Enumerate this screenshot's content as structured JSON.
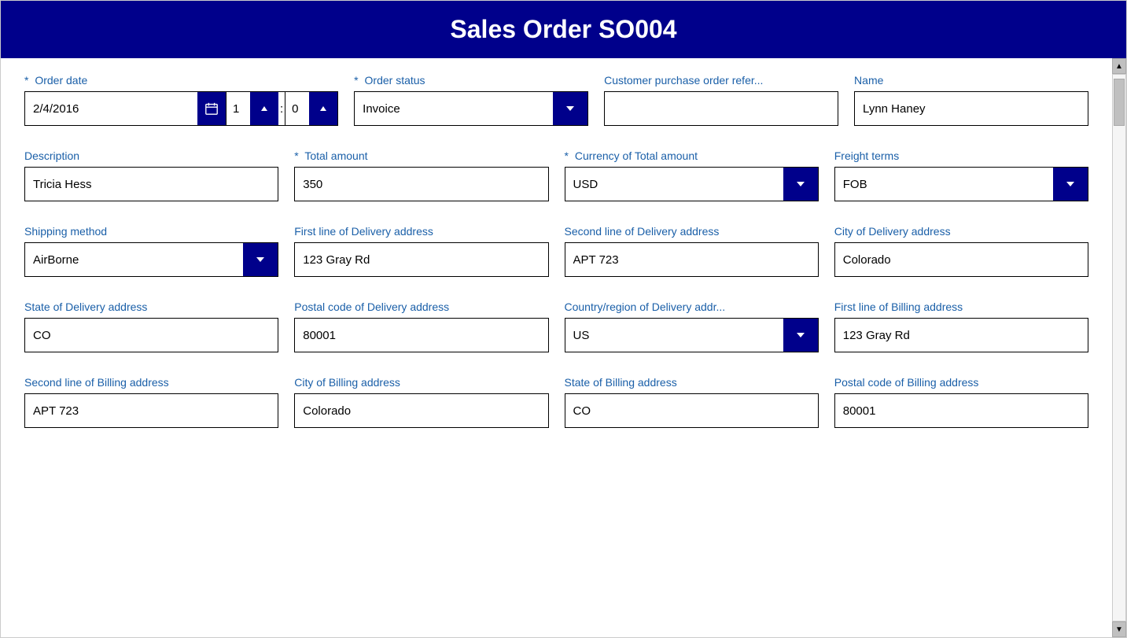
{
  "header": {
    "title": "Sales Order SO004"
  },
  "form": {
    "fields": {
      "order_date": {
        "label": "Order date",
        "required": true,
        "value": "2/4/2016",
        "hour": "1",
        "minute": "0"
      },
      "order_status": {
        "label": "Order status",
        "required": true,
        "value": "Invoice"
      },
      "customer_po_ref": {
        "label": "Customer purchase order refer...",
        "required": false,
        "value": ""
      },
      "name": {
        "label": "Name",
        "required": false,
        "value": "Lynn Haney"
      },
      "description": {
        "label": "Description",
        "required": false,
        "value": "Tricia Hess"
      },
      "total_amount": {
        "label": "Total amount",
        "required": true,
        "value": "350"
      },
      "currency_total": {
        "label": "Currency of Total amount",
        "required": true,
        "value": "USD"
      },
      "freight_terms": {
        "label": "Freight terms",
        "required": false,
        "value": "FOB"
      },
      "shipping_method": {
        "label": "Shipping method",
        "required": false,
        "value": "AirBorne"
      },
      "delivery_addr1": {
        "label": "First line of Delivery address",
        "required": false,
        "value": "123 Gray Rd"
      },
      "delivery_addr2": {
        "label": "Second line of Delivery address",
        "required": false,
        "value": "APT 723"
      },
      "delivery_city": {
        "label": "City of Delivery address",
        "required": false,
        "value": "Colorado"
      },
      "delivery_state": {
        "label": "State of Delivery address",
        "required": false,
        "value": "CO"
      },
      "delivery_postal": {
        "label": "Postal code of Delivery address",
        "required": false,
        "value": "80001"
      },
      "delivery_country": {
        "label": "Country/region of Delivery addr...",
        "required": false,
        "value": "US"
      },
      "billing_addr1": {
        "label": "First line of Billing address",
        "required": false,
        "value": "123 Gray Rd"
      },
      "billing_addr2": {
        "label": "Second line of Billing address",
        "required": false,
        "value": "APT 723"
      },
      "billing_city": {
        "label": "City of Billing address",
        "required": false,
        "value": "Colorado"
      },
      "billing_state": {
        "label": "State of Billing address",
        "required": false,
        "value": "CO"
      },
      "billing_postal": {
        "label": "Postal code of Billing address",
        "required": false,
        "value": "80001"
      }
    }
  }
}
